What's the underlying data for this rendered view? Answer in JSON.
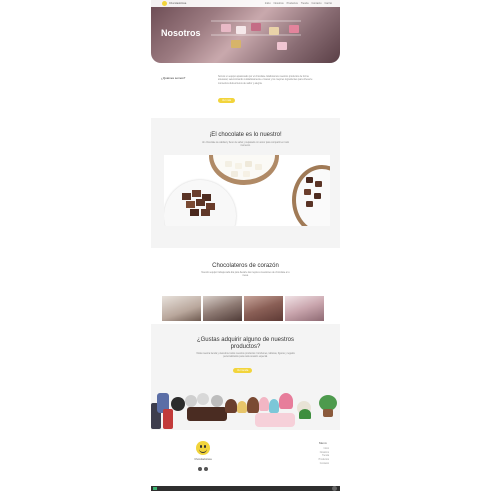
{
  "header": {
    "logo_text": "Chocoladorissa",
    "nav": [
      "Inicio",
      "Nosotros",
      "Productos",
      "Tienda",
      "Contacto",
      "Carrito"
    ],
    "hero_title": "Nosotros"
  },
  "about": {
    "label": "¿Quiénes somos?",
    "text": "Somos un equipo apasionado por el chocolate. Elaboramos nuestros productos de forma artesanal, seleccionando cuidadosamente el cacao y los mejores ingredientes para ofrecerte momentos dulces llenos de sabor y alegría.",
    "button": "Ver más"
  },
  "chocolate": {
    "title": "¡El chocolate es lo nuestro!",
    "text": "Un chocolate de calidad y lleno de sabor, preparado con amor para compartir en todo momento."
  },
  "team": {
    "title": "Chocolateros de corazón",
    "text": "Nuestro equipo trabaja cada día para llevarte las mejores creaciones de chocolate a tu mesa."
  },
  "products": {
    "title": "¿Gustas adquirir alguno de nuestros productos?",
    "text": "Visita nuestra tienda y descubre todos nuestros productos: bombones, tabletas, figuras y regalos personalizados para cada ocasión especial.",
    "button": "Ver tienda"
  },
  "footer": {
    "brand": "Chocoladorissa",
    "menu_title": "Menú",
    "menu_items": [
      "Inicio",
      "Nosotros",
      "Tienda",
      "Productos",
      "Contacto"
    ]
  },
  "colors": {
    "accent": "#f2d43b",
    "section_bg": "#f4f4f4",
    "chocolate": "#5a3426"
  }
}
